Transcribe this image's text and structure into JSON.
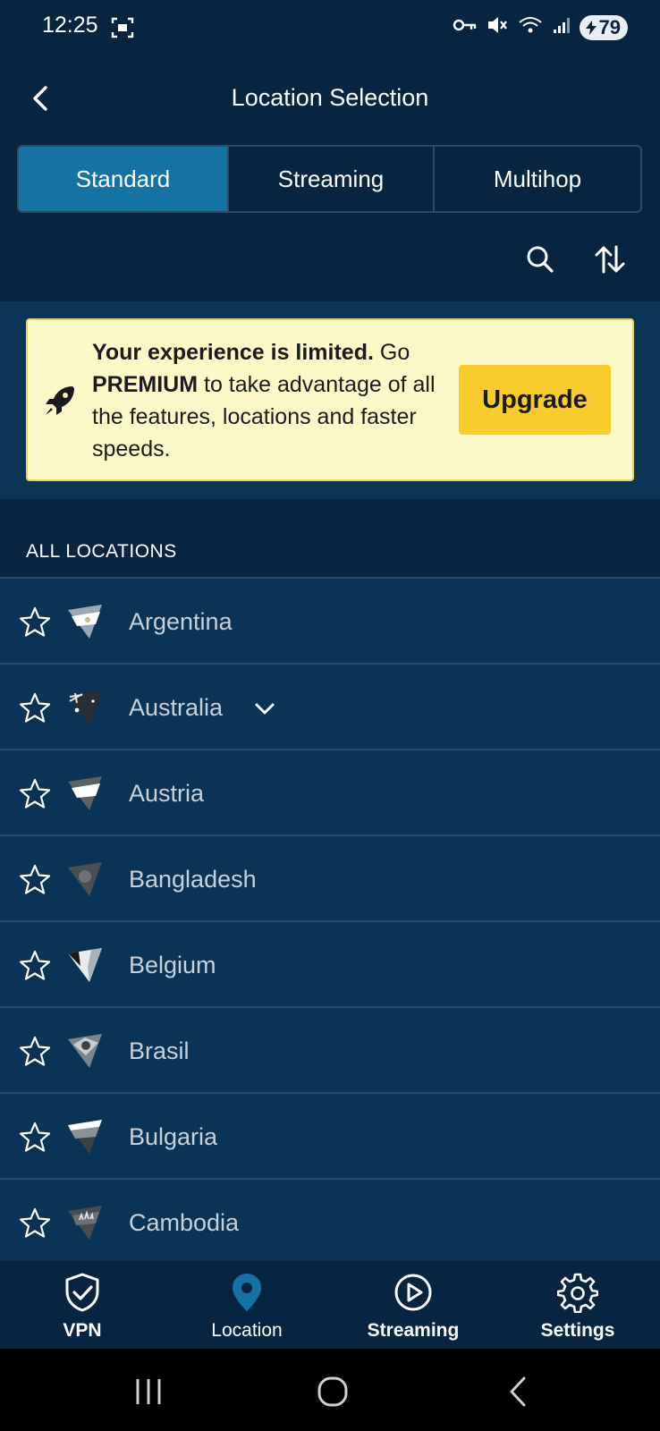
{
  "status_bar": {
    "time": "12:25",
    "battery": "79"
  },
  "header": {
    "title": "Location Selection"
  },
  "tabs": [
    {
      "label": "Standard",
      "active": true
    },
    {
      "label": "Streaming",
      "active": false
    },
    {
      "label": "Multihop",
      "active": false
    }
  ],
  "banner": {
    "bold_text": "Your experience is limited.",
    "text_1": " Go ",
    "premium": "PREMIUM",
    "text_2": " to take advantage of all the features, locations and faster speeds.",
    "button_label": "Upgrade"
  },
  "locations": {
    "section_label": "ALL LOCATIONS",
    "items": [
      {
        "name": "Argentina",
        "flag": "argentina-flag-icon"
      },
      {
        "name": "Australia",
        "flag": "australia-flag-icon",
        "expandable": true
      },
      {
        "name": "Austria",
        "flag": "austria-flag-icon"
      },
      {
        "name": "Bangladesh",
        "flag": "bangladesh-flag-icon"
      },
      {
        "name": "Belgium",
        "flag": "belgium-flag-icon"
      },
      {
        "name": "Brasil",
        "flag": "brasil-flag-icon"
      },
      {
        "name": "Bulgaria",
        "flag": "bulgaria-flag-icon"
      },
      {
        "name": "Cambodia",
        "flag": "cambodia-flag-icon"
      }
    ]
  },
  "bottom_nav": [
    {
      "label": "VPN",
      "icon": "shield-check-icon"
    },
    {
      "label": "Location",
      "icon": "location-pin-icon",
      "active": true
    },
    {
      "label": "Streaming",
      "icon": "play-circle-icon"
    },
    {
      "label": "Settings",
      "icon": "gear-icon"
    }
  ],
  "colors": {
    "background": "#072540",
    "row": "#0b3355",
    "accent": "#1573a3",
    "banner_bg": "#fdf8c8",
    "upgrade": "#f9cc2e"
  }
}
